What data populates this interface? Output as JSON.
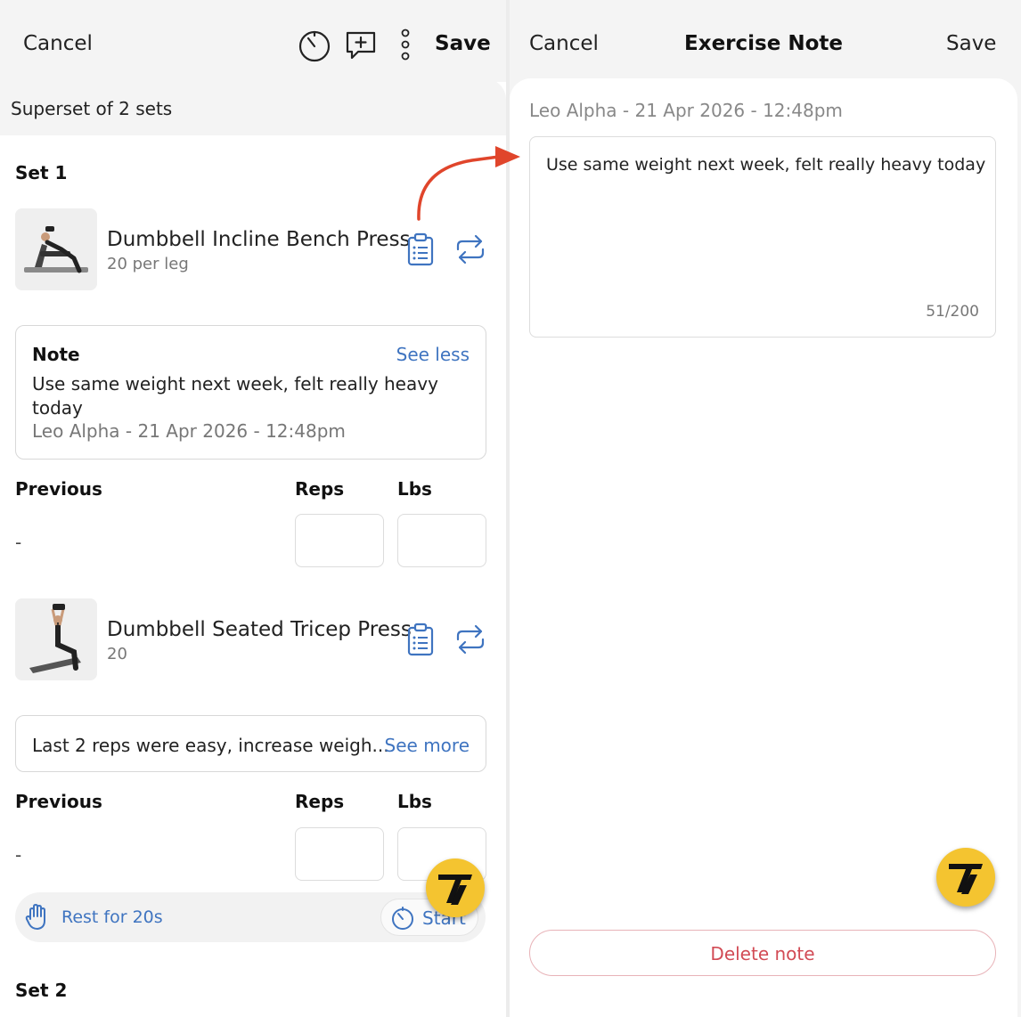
{
  "left": {
    "header": {
      "cancel_label": "Cancel",
      "save_label": "Save"
    },
    "superset_label": "Superset of 2 sets",
    "set1_title": "Set 1",
    "set2_title": "Set 2",
    "exercises": [
      {
        "name": "Dumbbell Incline Bench Press",
        "sub": "20 per leg",
        "note": {
          "heading": "Note",
          "link": "See less",
          "text": "Use same weight next week, felt really heavy today",
          "meta": "Leo Alpha - 21 Apr 2026 - 12:48pm"
        },
        "columns": {
          "previous": "Previous",
          "reps": "Reps",
          "lbs": "Lbs"
        },
        "previous_value": "-"
      },
      {
        "name": "Dumbbell Seated Tricep Press",
        "sub": "20",
        "note": {
          "text": "Last 2 reps were easy, increase weigh...",
          "link": "See more"
        },
        "columns": {
          "previous": "Previous",
          "reps": "Reps",
          "lbs": "Lbs"
        },
        "previous_value": "-"
      }
    ],
    "rest": {
      "label": "Rest for 20s",
      "start_label": "Start"
    }
  },
  "right": {
    "header": {
      "cancel_label": "Cancel",
      "title": "Exercise Note",
      "save_label": "Save"
    },
    "meta": "Leo Alpha - 21 Apr 2026 - 12:48pm",
    "note_text": "Use same weight next week, felt really heavy today",
    "char_count": "51/200",
    "delete_label": "Delete note"
  },
  "colors": {
    "accent_blue": "#3f74c0",
    "delete_red": "#d24b55",
    "arrow_red": "#e0452b",
    "logo_yellow": "#f4c430"
  },
  "icons": [
    "timer-icon",
    "add-comment-icon",
    "more-vertical-icon",
    "clipboard-note-icon",
    "swap-icon",
    "hand-icon",
    "app-logo-icon"
  ]
}
